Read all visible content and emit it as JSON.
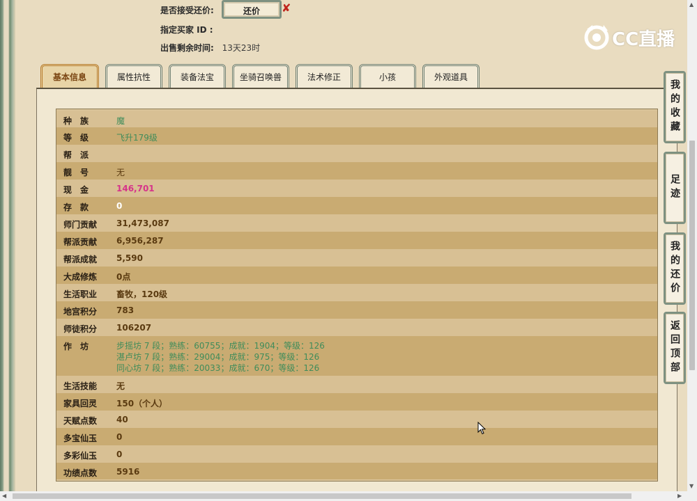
{
  "offer": {
    "accept_label": "是否接受还价:",
    "button_label": "还价",
    "buyer_label": "指定买家 ID :",
    "remaining_label": "出售剩余时间:",
    "remaining_value": "13天23时"
  },
  "logo": {
    "text": "CC直播"
  },
  "tabs": [
    {
      "label": "基本信息",
      "active": true
    },
    {
      "label": "属性抗性"
    },
    {
      "label": "装备法宝"
    },
    {
      "label": "坐骑召唤兽"
    },
    {
      "label": "法术修正"
    },
    {
      "label": "小孩"
    },
    {
      "label": "外观道具"
    }
  ],
  "rows": [
    {
      "label": "种　族",
      "value": "魔"
    },
    {
      "label": "等　级",
      "value": "飞升179级"
    },
    {
      "label": "帮　派",
      "value": ""
    },
    {
      "label": "靓　号",
      "value": "无"
    },
    {
      "label": "现　金",
      "value": "146,701"
    },
    {
      "label": "存　款",
      "value": "0"
    },
    {
      "label": "师门贡献",
      "value": "31,473,087"
    },
    {
      "label": "帮派贡献",
      "value": "6,956,287"
    },
    {
      "label": "帮派成就",
      "value": "5,590"
    },
    {
      "label": "大成修炼",
      "value": "0点"
    },
    {
      "label": "生活职业",
      "value": "畜牧，120级"
    },
    {
      "label": "地宫积分",
      "value": "783"
    },
    {
      "label": "师徒积分",
      "value": "106207"
    },
    {
      "label": "作　坊",
      "lines": [
        "步摇坊 7 段；熟练：60755；成就：1904；等级：126",
        "湛卢坊 7 段；熟练：29004；成就：975；等级：126",
        "同心坊 7 段；熟练：20033；成就：670；等级：126"
      ]
    },
    {
      "label": "生活技能",
      "value": "无"
    },
    {
      "label": "家具回灵",
      "value": "150（个人）"
    },
    {
      "label": "天赋点数",
      "value": "40"
    },
    {
      "label": "多宝仙玉",
      "value": "0"
    },
    {
      "label": "多彩仙玉",
      "value": "0"
    },
    {
      "label": "功绩点数",
      "value": "5916"
    }
  ],
  "side_buttons": [
    "我的收藏",
    "足迹",
    "我的还价",
    "返回顶部"
  ],
  "colors": {
    "accent_green": "#3f8c5a",
    "cash_pink": "#d6338a",
    "tab_active": "#b67a2a"
  }
}
